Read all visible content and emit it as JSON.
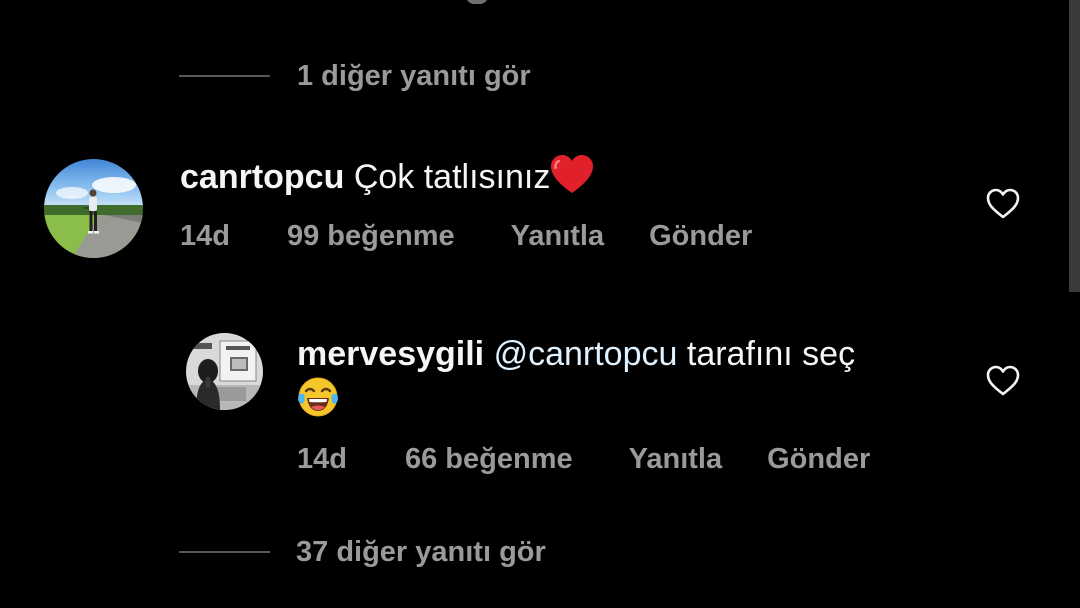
{
  "colors": {
    "background": "#000000",
    "text_primary": "#f5f5f5",
    "text_secondary": "#9a9a9a",
    "mention": "#e0f1ff",
    "heart_emoji": "#e0202a"
  },
  "replies_top": {
    "label": "1 diğer yanıtı gör"
  },
  "comments": [
    {
      "username": "canrtopcu",
      "text": "Çok tatlısınız",
      "emoji": "red-heart-emoji",
      "time": "14d",
      "likes": "99 beğenme",
      "reply_label": "Yanıtla",
      "send_label": "Gönder",
      "like_icon": "heart-outline-icon"
    },
    {
      "username": "mervesygili",
      "mention": "@canrtopcu",
      "text": "tarafını seç",
      "emoji": "face-with-tears-of-joy-emoji",
      "time": "14d",
      "likes": "66 beğenme",
      "reply_label": "Yanıtla",
      "send_label": "Gönder",
      "like_icon": "heart-outline-icon"
    }
  ],
  "replies_bottom": {
    "label": "37 diğer yanıtı gör"
  }
}
